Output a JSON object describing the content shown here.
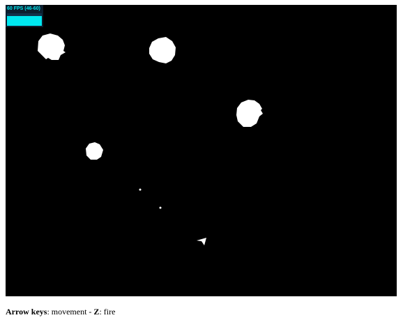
{
  "fps_meter": {
    "label": "60 FPS (46-60)",
    "fill_fraction": 0.78,
    "text_color": "#00e8f0",
    "background_color": "#0c1e2e"
  },
  "game": {
    "background_color": "#000000",
    "entity_color": "#ffffff",
    "asteroids": 4,
    "bullets": 2,
    "ship": "ship-icon"
  },
  "instructions": {
    "key1": "Arrow keys",
    "action1": ": movement - ",
    "key2": "Z",
    "action2": ": fire"
  }
}
